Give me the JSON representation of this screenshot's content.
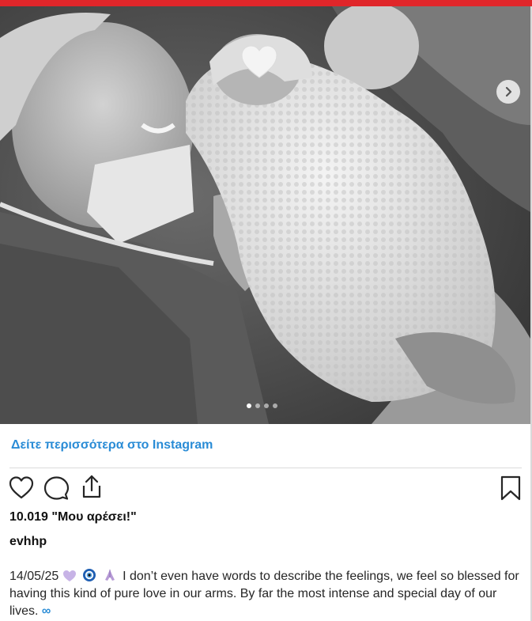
{
  "colors": {
    "accent_bar": "#e0262a",
    "link": "#2a8cd6",
    "text": "#111111",
    "divider": "#dbdbdb"
  },
  "media": {
    "description_icon": "heart-emoji-overlay",
    "carousel": {
      "total": 4,
      "active_index": 0
    }
  },
  "link": {
    "see_more_label": "Δείτε περισσότερα στο Instagram"
  },
  "actions": {
    "like_icon": "heart-outline-icon",
    "comment_icon": "speech-bubble-icon",
    "share_icon": "share-upload-icon",
    "save_icon": "bookmark-icon"
  },
  "post": {
    "likes_text": "10.019 \"Μου αρέσει!\"",
    "username": "evhhp",
    "caption_date": "14/05/25",
    "caption_body": " I don’t even have words to describe the feelings, we feel so blessed for having this kind of pure love in our arms. By far the most intense and special day of our lives.",
    "caption_emojis": [
      "purple-heart-emoji",
      "nazar-eye-emoji",
      "praying-hands-emoji"
    ],
    "caption_end_symbol": "∞"
  }
}
